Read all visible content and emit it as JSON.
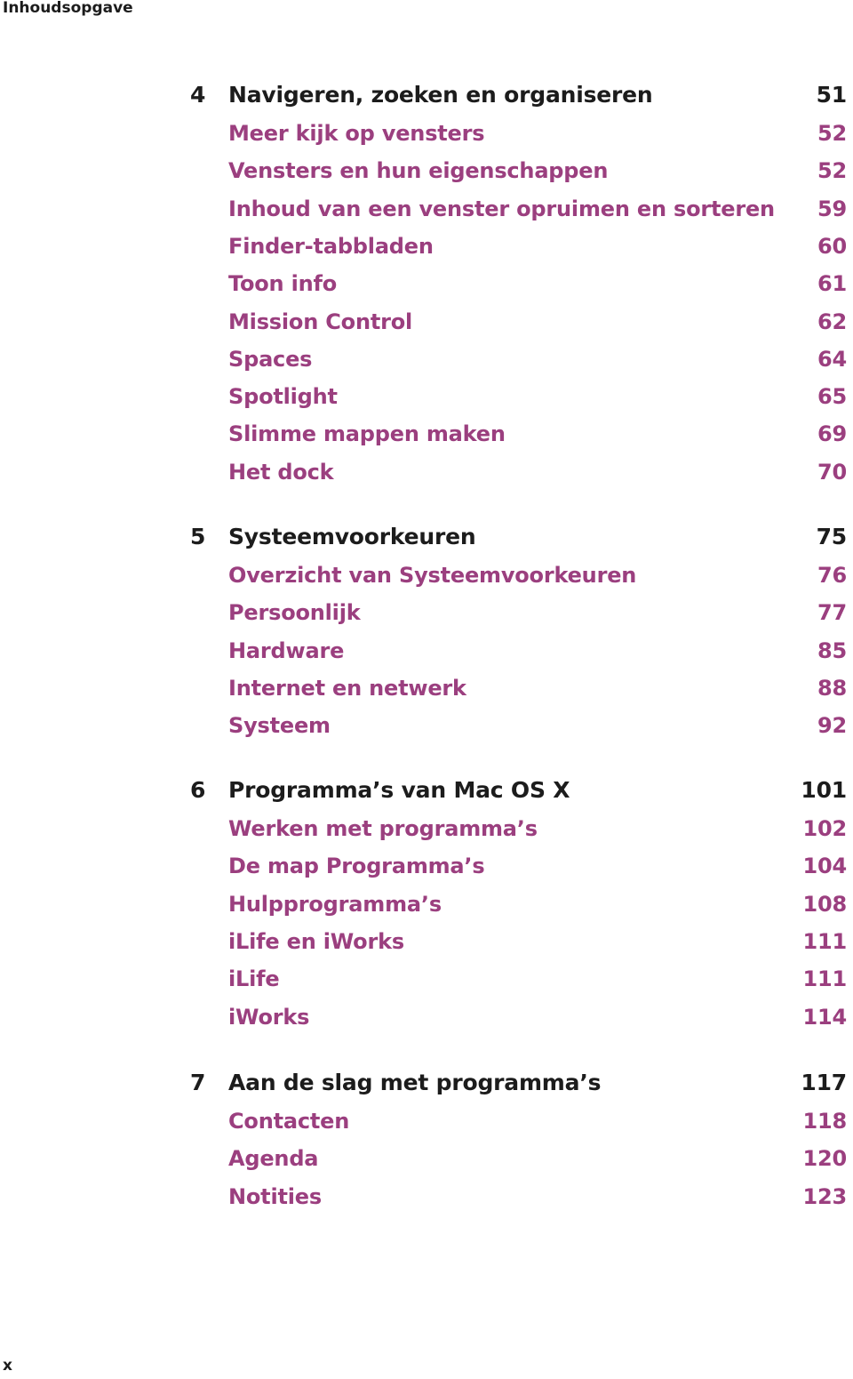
{
  "running_head": "Inhoudsopgave",
  "folio": "x",
  "colors": {
    "chapter": "#1c1c1c",
    "section": "#9b3f7f"
  },
  "chapters": [
    {
      "number": "4",
      "title": "Navigeren, zoeken en organiseren",
      "page": "51",
      "sections": [
        {
          "title": "Meer kijk op vensters",
          "page": "52"
        },
        {
          "title": "Vensters en hun eigenschappen",
          "page": "52"
        },
        {
          "title": "Inhoud van een venster opruimen en sorteren",
          "page": "59"
        },
        {
          "title": "Finder-tabbladen",
          "page": "60"
        },
        {
          "title": "Toon info",
          "page": "61"
        },
        {
          "title": "Mission Control",
          "page": "62"
        },
        {
          "title": "Spaces",
          "page": "64"
        },
        {
          "title": "Spotlight",
          "page": "65"
        },
        {
          "title": "Slimme mappen maken",
          "page": "69"
        },
        {
          "title": "Het dock",
          "page": "70"
        }
      ]
    },
    {
      "number": "5",
      "title": "Systeemvoorkeuren",
      "page": "75",
      "sections": [
        {
          "title": "Overzicht van Systeemvoorkeuren",
          "page": "76"
        },
        {
          "title": "Persoonlijk",
          "page": "77"
        },
        {
          "title": "Hardware",
          "page": "85"
        },
        {
          "title": "Internet en netwerk",
          "page": "88"
        },
        {
          "title": "Systeem",
          "page": "92"
        }
      ]
    },
    {
      "number": "6",
      "title": "Programma’s van Mac OS X",
      "page": "101",
      "sections": [
        {
          "title": "Werken met programma’s",
          "page": "102"
        },
        {
          "title": "De map Programma’s",
          "page": "104"
        },
        {
          "title": "Hulpprogramma’s",
          "page": "108"
        },
        {
          "title": "iLife en iWorks",
          "page": "111"
        },
        {
          "title": "iLife",
          "page": "111"
        },
        {
          "title": "iWorks",
          "page": "114"
        }
      ]
    },
    {
      "number": "7",
      "title": "Aan de slag met programma’s",
      "page": "117",
      "sections": [
        {
          "title": "Contacten",
          "page": "118"
        },
        {
          "title": "Agenda",
          "page": "120"
        },
        {
          "title": "Notities",
          "page": "123"
        }
      ]
    }
  ]
}
